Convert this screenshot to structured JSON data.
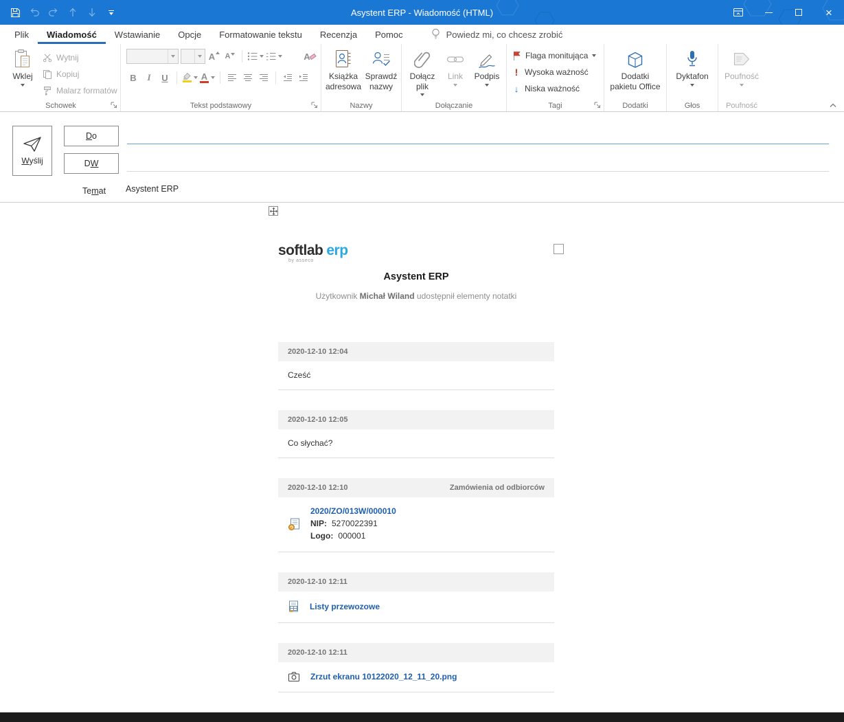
{
  "glyphs": {
    "close": "×"
  },
  "titlebar": {
    "title": "Asystent ERP  -  Wiadomość (HTML)"
  },
  "tabs": {
    "file": "Plik",
    "message": "Wiadomość",
    "insert": "Wstawianie",
    "options": "Opcje",
    "format_text": "Formatowanie tekstu",
    "review": "Recenzja",
    "help": "Pomoc",
    "tell_me": "Powiedz mi, co chcesz zrobić"
  },
  "ribbon": {
    "clipboard": {
      "label": "Schowek",
      "paste": "Wklej",
      "cut": "Wytnij",
      "copy": "Kopiuj",
      "format_painter": "Malarz formatów"
    },
    "basic_text": {
      "label": "Tekst podstawowy",
      "bold": "B",
      "italic": "I",
      "underline": "U",
      "grow": "A",
      "shrink": "A",
      "color_letter": "A",
      "clear_letter": "A"
    },
    "names": {
      "label": "Nazwy",
      "address_book": "Książka adresowa",
      "check_names": "Sprawdź nazwy"
    },
    "include": {
      "label": "Dołączanie",
      "attach_file": "Dołącz plik",
      "link": "Link",
      "signature": "Podpis"
    },
    "tags": {
      "label": "Tagi",
      "follow_up": "Flaga monitująca",
      "high": "Wysoka ważność",
      "low": "Niska ważność",
      "high_glyph": "!",
      "low_glyph": "↓"
    },
    "addins": {
      "label": "Dodatki",
      "office_addins": "Dodatki pakietu Office"
    },
    "voice": {
      "label": "Głos",
      "dictate": "Dyktafon"
    },
    "sensitivity": {
      "label": "Poufność",
      "button": "Poufność"
    }
  },
  "compose": {
    "send_accel": "W",
    "send_rest": "yślij",
    "to_accel": "D",
    "to_rest": "o",
    "cc_pre": "D",
    "cc_accel": "W",
    "subject_pre": "Te",
    "subject_accel": "m",
    "subject_post": "at",
    "subject_value": "Asystent ERP"
  },
  "message": {
    "logo_softlab": "softlab",
    "logo_erp": "erp",
    "logo_by": "by asseco",
    "title": "Asystent ERP",
    "subtitle_prefix": "Użytkownik",
    "subtitle_user": "Michał Wiland",
    "subtitle_suffix": "udostępnił elementy notatki",
    "cards": [
      {
        "timestamp": "2020-12-10 12:04",
        "text": "Cześć"
      },
      {
        "timestamp": "2020-12-10 12:05",
        "text": "Co słychać?"
      },
      {
        "timestamp": "2020-12-10 12:10",
        "category": "Zamówienia od odbiorców",
        "link": "2020/ZO/013W/000010",
        "fields": [
          {
            "label": "NIP:",
            "value": "5270022391"
          },
          {
            "label": "Logo:",
            "value": "000001"
          }
        ]
      },
      {
        "timestamp": "2020-12-10 12:11",
        "link": "Listy przewozowe"
      },
      {
        "timestamp": "2020-12-10 12:11",
        "link": "Zrzut ekranu 10122020_12_11_20.png"
      }
    ]
  },
  "colors": {
    "titlebar_blue": "#1a78d4",
    "accent_blue": "#2b6cb8",
    "link_blue": "#1d5fae",
    "flag_red": "#d6402e",
    "importance_red": "#c0392b",
    "low_importance_blue": "#2f6fb5"
  }
}
